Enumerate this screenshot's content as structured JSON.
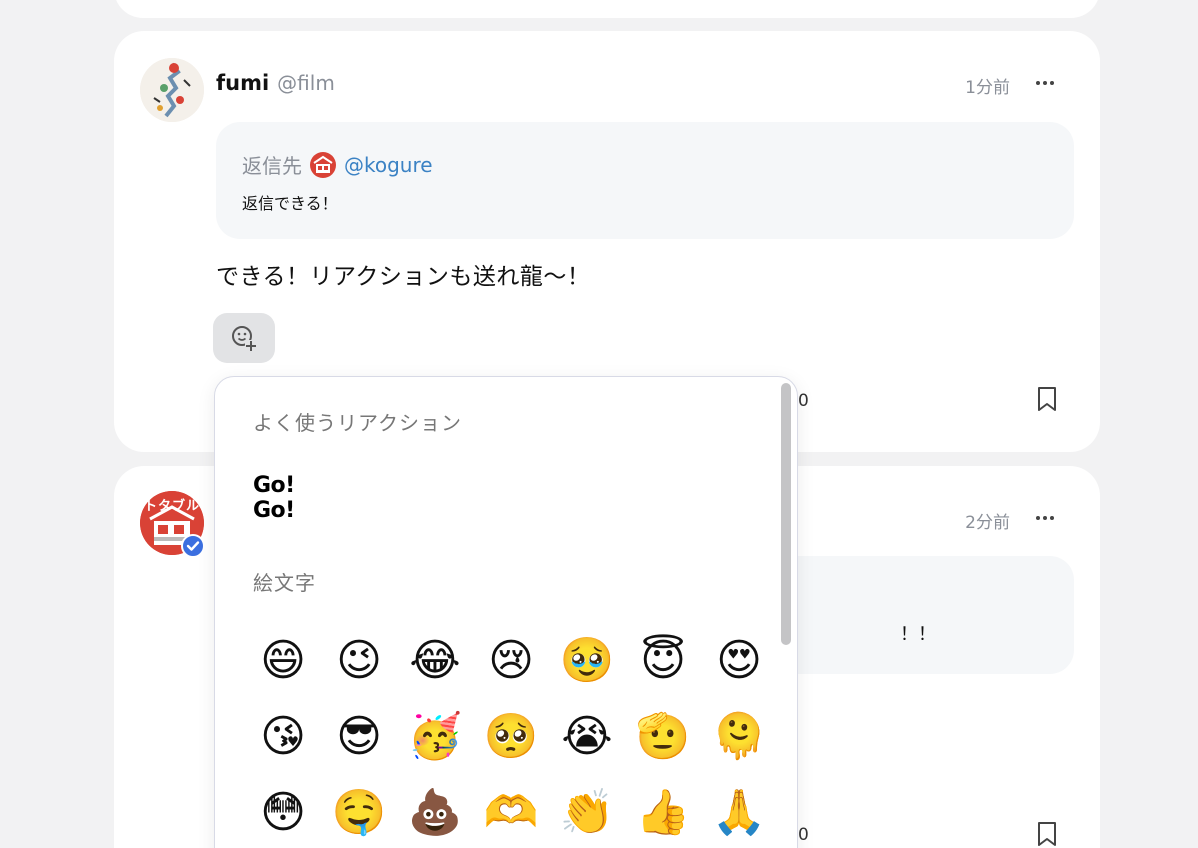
{
  "post1": {
    "display_name": "fumi",
    "handle": "@film",
    "time": "1分前",
    "reply_label": "返信先",
    "reply_to": "@kogure",
    "reply_text": "返信できる！",
    "text": "できる！リアクションも送れ龍〜！",
    "count": "0"
  },
  "post2": {
    "avatar_text": "トタブル",
    "time": "2分前",
    "quote_tail": "！！",
    "count": "0"
  },
  "picker": {
    "frequent_title": "よく使うリアクション",
    "gogo_line1": "Go!",
    "gogo_line2": "Go!",
    "emoji_title": "絵文字",
    "emojis": [
      "😄",
      "😉",
      "😂",
      "😢",
      "🥹",
      "😇",
      "😍",
      "😘",
      "😎",
      "🥳",
      "🥺",
      "😭",
      "🫡",
      "🫠",
      "😳",
      "🤤",
      "💩",
      "🫶",
      "👏",
      "👍",
      "🙏"
    ]
  },
  "colors": {
    "accent_link": "#3b82c4",
    "verified": "#3b6fe0",
    "avatar_red": "#d94236"
  }
}
